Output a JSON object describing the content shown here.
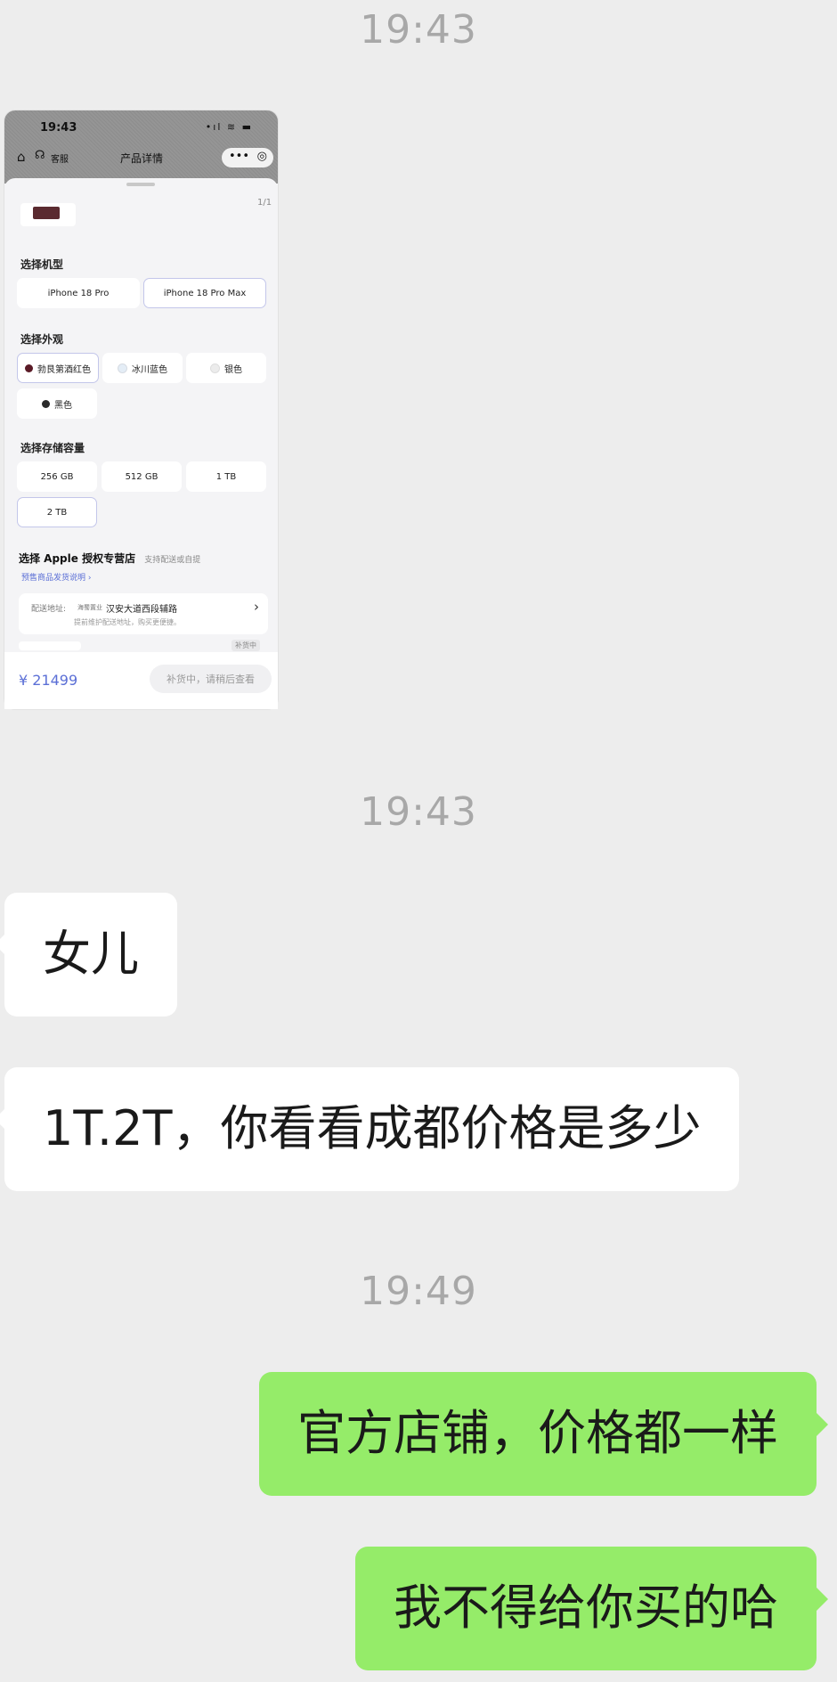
{
  "timestamps": [
    "19:43",
    "19:43",
    "19:49"
  ],
  "screenshot": {
    "status_time": "19:43",
    "status_icons": "•ıl ≋ ▬",
    "customer_service": "客服",
    "title": "产品详情",
    "pager": "1/1",
    "model_section": "选择机型",
    "models": [
      {
        "label": "iPhone 18 Pro",
        "selected": false
      },
      {
        "label": "iPhone 18 Pro Max",
        "selected": true
      }
    ],
    "color_section": "选择外观",
    "colors": [
      {
        "label": "勃艮第酒红色",
        "swatch": "#5a1a26",
        "selected": true
      },
      {
        "label": "冰川蓝色",
        "swatch": "#e4edf6",
        "selected": false
      },
      {
        "label": "银色",
        "swatch": "#ececec",
        "selected": false
      },
      {
        "label": "黑色",
        "swatch": "#2a2a2a",
        "selected": false
      }
    ],
    "storage_section": "选择存储容量",
    "storage": [
      {
        "label": "256 GB",
        "selected": false
      },
      {
        "label": "512 GB",
        "selected": false
      },
      {
        "label": "1 TB",
        "selected": false
      },
      {
        "label": "2 TB",
        "selected": true
      }
    ],
    "store_title": "选择 Apple 授权专营店",
    "store_sub": "支持配送或自提",
    "preorder_link": "预售商品发货说明",
    "address_label": "配送地址:",
    "address_tag": "海蜀置业",
    "address_value": "汉安大道西段辅路",
    "address_note": "提前维护配送地址，购买更便捷。",
    "peek_badge": "补货中",
    "price": "¥ 21499",
    "restock_button": "补货中，请稍后查看"
  },
  "messages": [
    {
      "side": "in",
      "text": "女儿"
    },
    {
      "side": "in",
      "text": "1T.2T，你看看成都价格是多少"
    },
    {
      "side": "out",
      "text": "官方店铺，价格都一样"
    },
    {
      "side": "out",
      "text": "我不得给你买的哈"
    }
  ],
  "colors": {
    "chat_bg": "#ededed",
    "incoming_bubble": "#ffffff",
    "outgoing_bubble": "#95ec69",
    "timestamp": "#a8a8a8",
    "accent": "#5b6fd6"
  }
}
